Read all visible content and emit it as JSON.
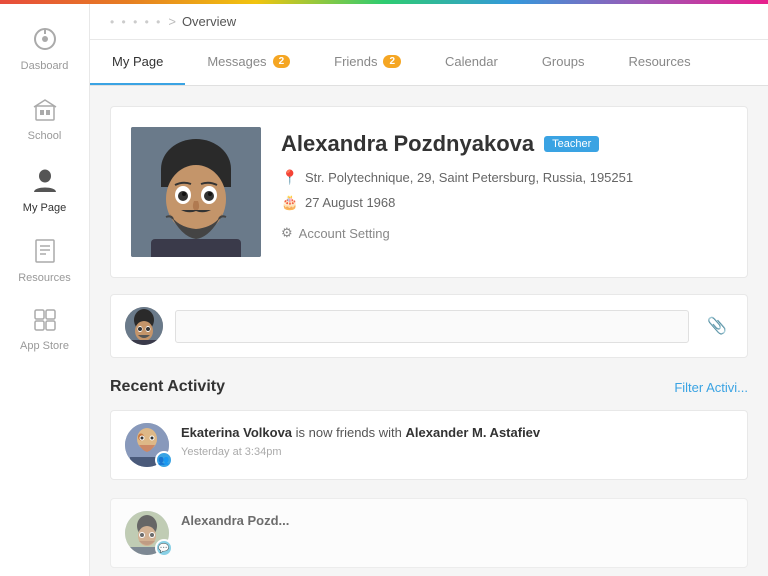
{
  "rainbow": true,
  "breadcrumb": {
    "home": ".........",
    "separator": ">",
    "current": "Overview"
  },
  "sidebar": {
    "items": [
      {
        "id": "dashboard",
        "label": "Dasboard",
        "icon": "⚙",
        "active": false
      },
      {
        "id": "school",
        "label": "School",
        "icon": "🏫",
        "active": false
      },
      {
        "id": "mypage",
        "label": "My Page",
        "icon": "👤",
        "active": true
      },
      {
        "id": "resources",
        "label": "Resources",
        "icon": "📖",
        "active": false
      },
      {
        "id": "appstore",
        "label": "App Store",
        "icon": "📱",
        "active": false
      }
    ]
  },
  "tabs": [
    {
      "id": "mypage",
      "label": "My Page",
      "active": true,
      "badge": null
    },
    {
      "id": "messages",
      "label": "Messages",
      "active": false,
      "badge": "2"
    },
    {
      "id": "friends",
      "label": "Friends",
      "active": false,
      "badge": "2"
    },
    {
      "id": "calendar",
      "label": "Calendar",
      "active": false,
      "badge": null
    },
    {
      "id": "groups",
      "label": "Groups",
      "active": false,
      "badge": null
    },
    {
      "id": "resources",
      "label": "Resources",
      "active": false,
      "badge": null
    }
  ],
  "profile": {
    "name": "Alexandra Pozdnyakova",
    "role_badge": "Teacher",
    "address": "Str. Polytechnique, 29, Saint Petersburg, Russia, 195251",
    "birthday": "27 August 1968",
    "account_setting": "Account Setting"
  },
  "post_box": {
    "placeholder": ""
  },
  "recent_activity": {
    "title": "Recent Activity",
    "filter_label": "Filter Activi...",
    "items": [
      {
        "id": 1,
        "user": "Ekaterina Volkova",
        "action": "is now friends with",
        "target": "Alexander M. Astafiev",
        "time": "Yesterday at 3:34pm",
        "badge_icon": "👥"
      },
      {
        "id": 2,
        "user": "Alexandra Pozd...",
        "action": "",
        "target": "",
        "time": "",
        "badge_icon": "💬"
      }
    ]
  }
}
